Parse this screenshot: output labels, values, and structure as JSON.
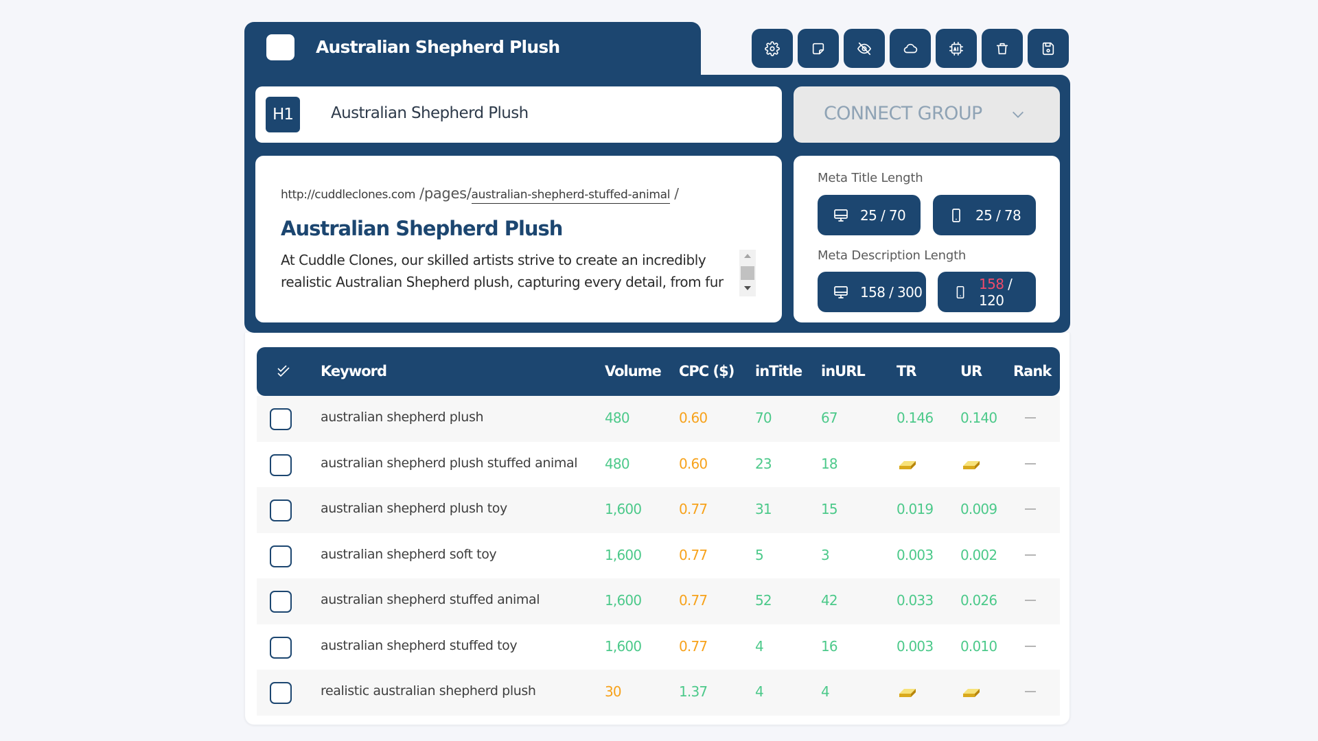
{
  "header": {
    "title": "Australian Shepherd Plush",
    "toolbar": [
      {
        "name": "settings",
        "icon": "gear-icon"
      },
      {
        "name": "note",
        "icon": "sticky-note-icon"
      },
      {
        "name": "hide",
        "icon": "eye-off-icon"
      },
      {
        "name": "cloud",
        "icon": "cloud-icon"
      },
      {
        "name": "ai",
        "icon": "ai-chip-icon"
      },
      {
        "name": "delete",
        "icon": "trash-icon"
      },
      {
        "name": "save",
        "icon": "floppy-disk-icon"
      }
    ]
  },
  "h1": {
    "badge": "H1",
    "value": "Australian Shepherd Plush"
  },
  "connect_group": {
    "label": "CONNECT GROUP"
  },
  "serp": {
    "domain": "http://cuddleclones.com",
    "path": "/pages/",
    "slug": "australian-shepherd-stuffed-animal",
    "trailing": "/",
    "title": "Australian Shepherd Plush",
    "description": "At Cuddle Clones, our skilled artists strive to create an incredibly realistic Australian Shepherd plush, capturing every detail, from fur"
  },
  "meta": {
    "title_label": "Meta Title Length",
    "title_desktop": {
      "current": "25",
      "max": "70"
    },
    "title_mobile": {
      "current": "25",
      "max": "78"
    },
    "desc_label": "Meta Description Length",
    "desc_desktop": {
      "current": "158",
      "max": "300"
    },
    "desc_mobile": {
      "current": "158",
      "max": "120"
    },
    "over_limit_color": "#f04a6a"
  },
  "table": {
    "columns": [
      "Keyword",
      "Volume",
      "CPC ($)",
      "inTitle",
      "inURL",
      "TR",
      "UR",
      "Rank"
    ],
    "rows": [
      {
        "keyword": "australian shepherd plush",
        "volume": "480",
        "volume_color": "green",
        "cpc": "0.60",
        "cpc_color": "orange",
        "intitle": "70",
        "inurl": "67",
        "tr": "0.146",
        "ur": "0.140",
        "rank": "—"
      },
      {
        "keyword": "australian shepherd plush stuffed animal",
        "volume": "480",
        "volume_color": "green",
        "cpc": "0.60",
        "cpc_color": "orange",
        "intitle": "23",
        "inurl": "18",
        "tr": "gold-bar",
        "ur": "gold-bar",
        "rank": "—"
      },
      {
        "keyword": "australian shepherd plush toy",
        "volume": "1,600",
        "volume_color": "green",
        "cpc": "0.77",
        "cpc_color": "orange",
        "intitle": "31",
        "inurl": "15",
        "tr": "0.019",
        "ur": "0.009",
        "rank": "—"
      },
      {
        "keyword": "australian shepherd soft toy",
        "volume": "1,600",
        "volume_color": "green",
        "cpc": "0.77",
        "cpc_color": "orange",
        "intitle": "5",
        "inurl": "3",
        "tr": "0.003",
        "ur": "0.002",
        "rank": "—"
      },
      {
        "keyword": "australian shepherd stuffed animal",
        "volume": "1,600",
        "volume_color": "green",
        "cpc": "0.77",
        "cpc_color": "orange",
        "intitle": "52",
        "inurl": "42",
        "tr": "0.033",
        "ur": "0.026",
        "rank": "—"
      },
      {
        "keyword": "australian shepherd stuffed toy",
        "volume": "1,600",
        "volume_color": "green",
        "cpc": "0.77",
        "cpc_color": "orange",
        "intitle": "4",
        "inurl": "16",
        "tr": "0.003",
        "ur": "0.010",
        "rank": "—"
      },
      {
        "keyword": "realistic australian shepherd plush",
        "volume": "30",
        "volume_color": "orange",
        "cpc": "1.37",
        "cpc_color": "green",
        "intitle": "4",
        "inurl": "4",
        "tr": "gold-bar",
        "ur": "gold-bar",
        "rank": "—"
      }
    ]
  },
  "colors": {
    "primary": "#1c4670",
    "good": "#4cc98a",
    "warn": "#f7a21b",
    "bad": "#f04a6a"
  }
}
